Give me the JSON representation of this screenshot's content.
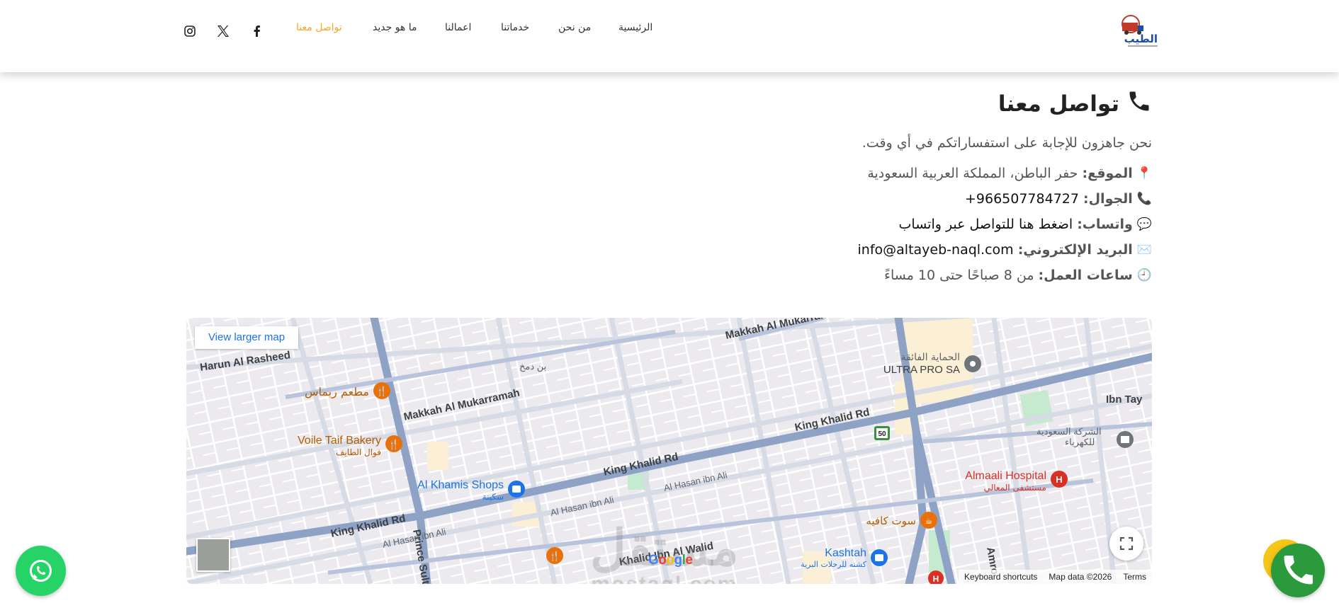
{
  "header": {
    "logo_text": "الطيب",
    "nav": [
      {
        "label": "الرئيسية",
        "active": false
      },
      {
        "label": "من نحن",
        "active": false
      },
      {
        "label": "خدماتنا",
        "active": false
      },
      {
        "label": "اعمالنا",
        "active": false
      },
      {
        "label": "ما هو جديد",
        "active": false
      },
      {
        "label": "تواصل معنا",
        "active": true
      }
    ],
    "social": [
      "facebook-icon",
      "x-icon",
      "instagram-icon"
    ]
  },
  "contact": {
    "title": "تواصل معنا",
    "subtitle": "نحن جاهزون للإجابة على استفساراتكم في أي وقت.",
    "location_label": "الموقع:",
    "location_value": "حفر الباطن، المملكة العربية السعودية",
    "phone_label": "الجوال:",
    "phone_value": "966507784727+",
    "whatsapp_label": "واتساب:",
    "whatsapp_value": "اضغط هنا للتواصل عبر واتساب",
    "email_label": "البريد الإلكتروني:",
    "email_value": "info@altayeb-naql.com",
    "hours_label": "ساعات العمل:",
    "hours_value": "من 8 صباحًا حتى 10 مساءً"
  },
  "map": {
    "view_larger": "View larger map",
    "keyboard_shortcuts": "Keyboard shortcuts",
    "map_data": "Map data ©2026",
    "terms": "Terms",
    "google": "Google",
    "watermark_ar": "مستقل",
    "watermark_en": "mostaql.com",
    "labels": {
      "harun": "Harun Al Rasheed",
      "makkah1": "Makkah Al Mukarramah",
      "makkah2": "Makkah Al Mukarram",
      "king_khalid1": "King Khalid Rd",
      "king_khalid2": "King Khalid Rd",
      "king_khalid3": "King Khalid Rd",
      "khalid_walid": "Khalid Ibn Al Walid",
      "hasan1": "Al Hasan ibn Ali",
      "hasan2": "Al Hasan ibn Ali",
      "hasan3": "Al Hasan ibn Ali",
      "ibn_tay": "Ibn Tay",
      "prince": "Prince Sult",
      "amr": "Amro",
      "rimas": "مطعم ريماس",
      "voile": "Voile Taif Bakery",
      "voile_ar": "فوال الطايف",
      "khamis": "Al Khamis Shops",
      "khamis_ar": "سكينة",
      "ultra": "ULTRA PRO SA",
      "ultra_ar": "الحماية الفائقة",
      "almaali": "Almaali Hospital",
      "almaali_ar": "مستشفى المعالي",
      "kashtah": "Kashtah",
      "kashtah_ar": "كشته للرحلات البرية",
      "sout": "سوت كافيه",
      "saudi_elec": "الشركة السعودية",
      "saudi_elec2": "للكهرباء",
      "dumakh": "بن دمخ",
      "road50": "50"
    }
  },
  "colors": {
    "accent": "#f5a623",
    "whatsapp": "#25d366",
    "call": "#2a9a3c",
    "call_ring": "#f5c518",
    "map_link": "#1a73e8"
  }
}
